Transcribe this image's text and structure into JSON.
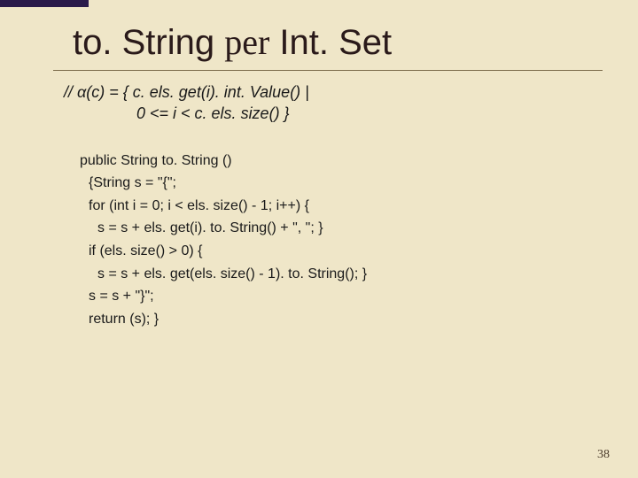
{
  "title": {
    "part1": "to. String ",
    "per": "per",
    "part2": " Int. Set"
  },
  "spec": {
    "line1": "// α(c) = { c. els. get(i). int. Value() |",
    "line2": "0 <= i < c. els. size() }"
  },
  "code": {
    "l1": "public String to. String ()",
    "l2": "{String s = \"{\";",
    "l3": "for (int i = 0; i < els. size() - 1; i++) {",
    "l4": "s = s + els. get(i). to. String() + \", \"; }",
    "l5": "if (els. size() > 0) {",
    "l6": "s = s + els. get(els. size() - 1). to. String(); }",
    "l7": "s = s + \"}\";",
    "l8": "return (s); }"
  },
  "pagenum": "38"
}
